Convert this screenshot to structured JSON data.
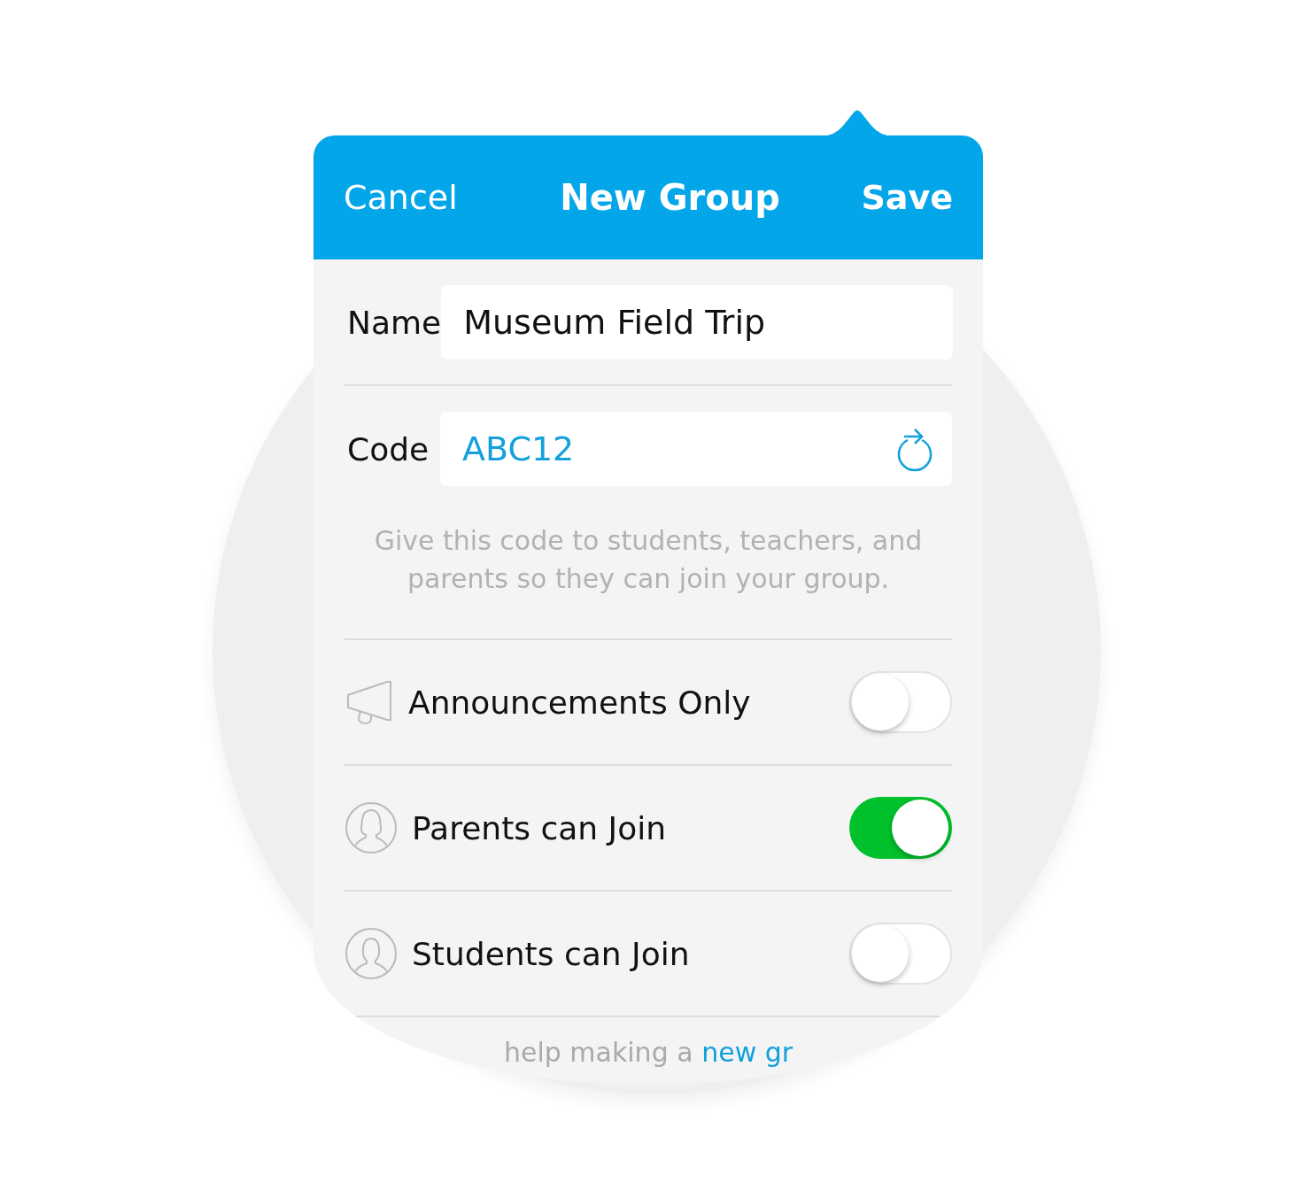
{
  "header": {
    "cancel": "Cancel",
    "title": "New Group",
    "save": "Save"
  },
  "fields": [
    {
      "label": "Name",
      "value": "Museum Field Trip",
      "kind": "text"
    },
    {
      "label": "Code",
      "value": "ABC12",
      "kind": "code"
    }
  ],
  "help_text": "Give this code to students, teachers, and parents so they can join your group.",
  "options": [
    {
      "kind": "announcement",
      "label": "Announcements Only",
      "on": false
    },
    {
      "kind": "parent",
      "label": "Parents can Join",
      "on": true
    },
    {
      "kind": "student",
      "label": "Students can Join",
      "on": false
    }
  ],
  "footer": {
    "text": "help making a",
    "link": "new gr"
  }
}
